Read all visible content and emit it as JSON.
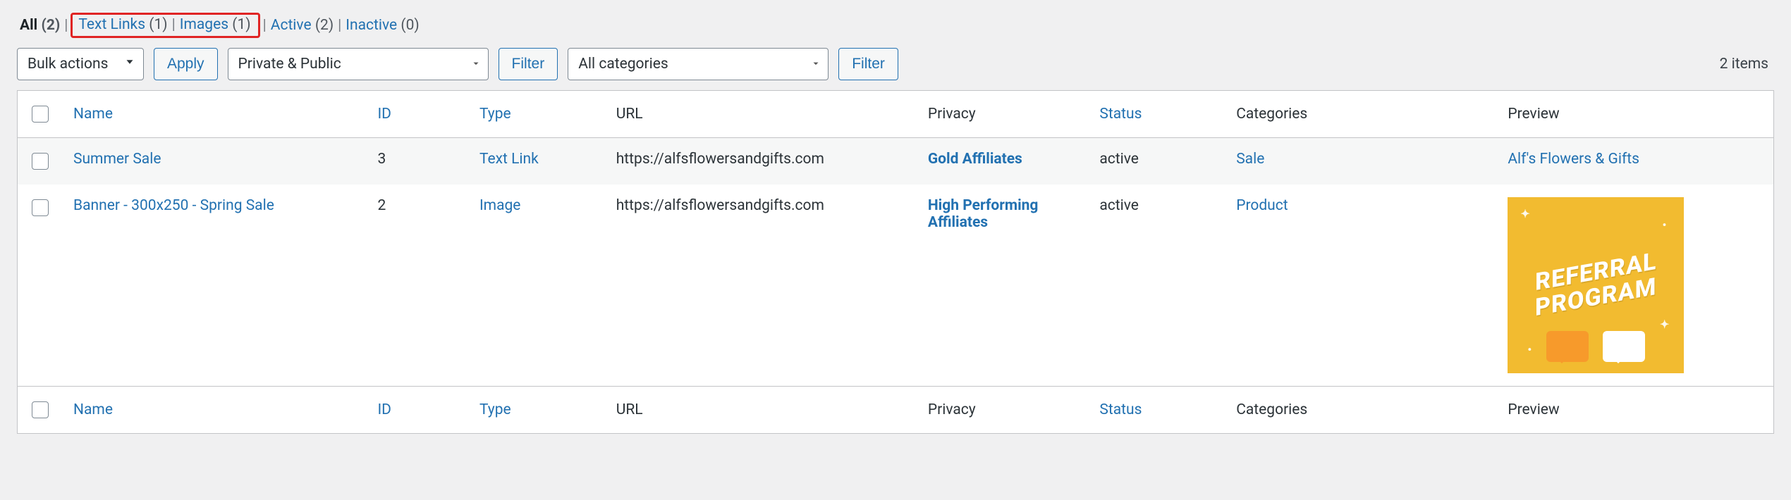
{
  "filters": {
    "all": {
      "label": "All",
      "count": 2
    },
    "textlinks": {
      "label": "Text Links",
      "count": 1
    },
    "images": {
      "label": "Images",
      "count": 1
    },
    "active": {
      "label": "Active",
      "count": 2
    },
    "inactive": {
      "label": "Inactive",
      "count": 0
    }
  },
  "bulk": {
    "label": "Bulk actions",
    "apply": "Apply"
  },
  "privacy_select": {
    "label": "Private & Public",
    "filter": "Filter"
  },
  "category_select": {
    "label": "All categories",
    "filter": "Filter"
  },
  "items_count": "2 items",
  "columns": {
    "name": "Name",
    "id": "ID",
    "type": "Type",
    "url": "URL",
    "privacy": "Privacy",
    "status": "Status",
    "categories": "Categories",
    "preview": "Preview"
  },
  "rows": [
    {
      "name": "Summer Sale",
      "id": "3",
      "type": "Text Link",
      "url": "https://alfsflowersandgifts.com",
      "privacy": "Gold Affiliates",
      "status": "active",
      "category": "Sale",
      "preview_text": "Alf's Flowers & Gifts",
      "preview_kind": "text"
    },
    {
      "name": "Banner - 300x250 - Spring Sale",
      "id": "2",
      "type": "Image",
      "url": "https://alfsflowersandgifts.com",
      "privacy": "High Performing Affiliates",
      "status": "active",
      "category": "Product",
      "preview_text": "REFERRAL PROGRAM",
      "preview_kind": "banner"
    }
  ],
  "banner": {
    "line1": "REFERRAL",
    "line2": "PROGRAM"
  }
}
